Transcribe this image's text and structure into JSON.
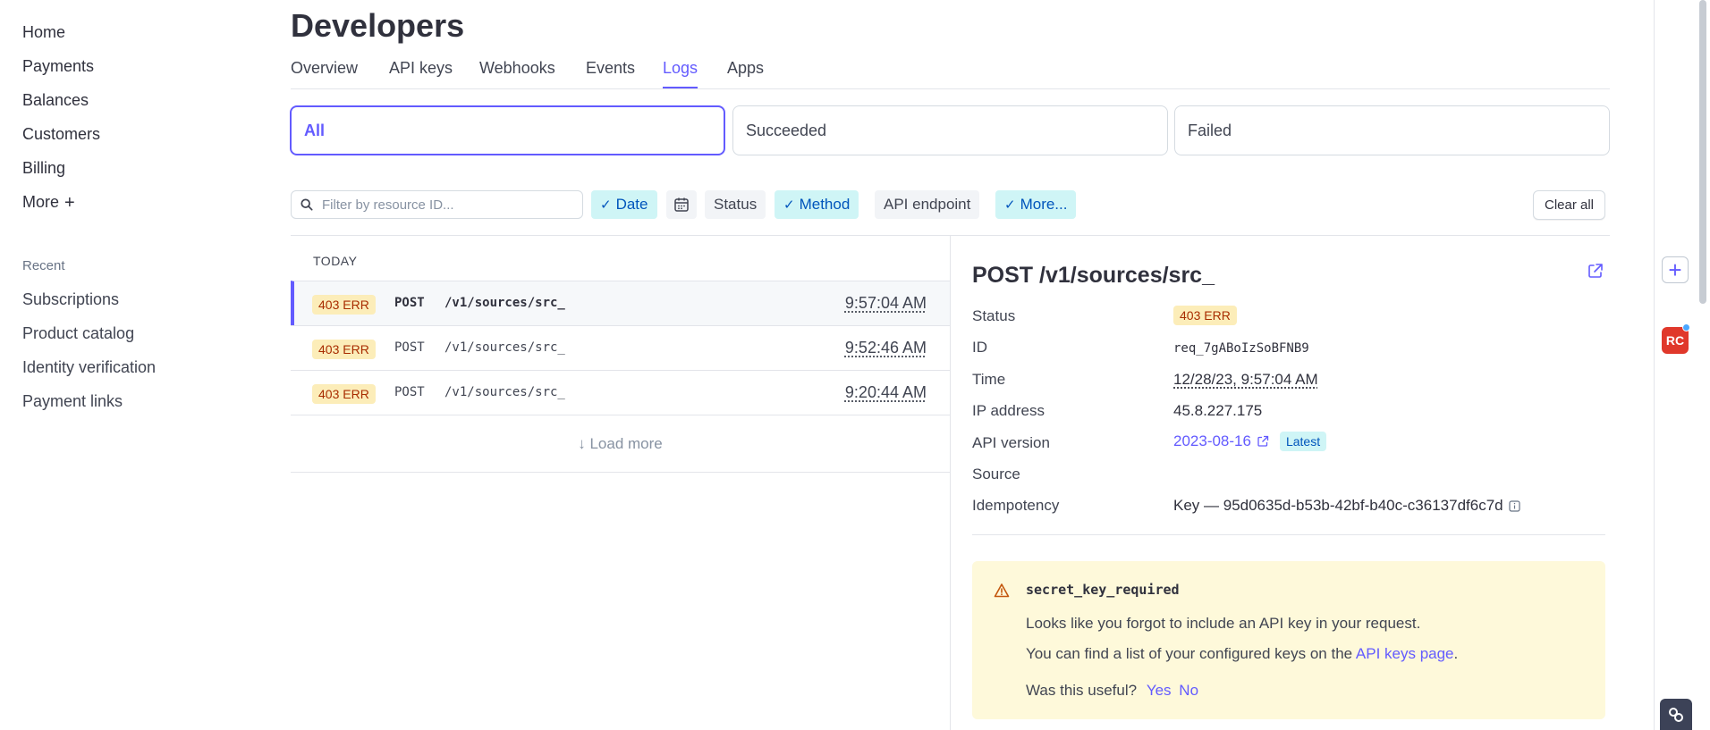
{
  "sidebar": {
    "nav": [
      "Home",
      "Payments",
      "Balances",
      "Customers",
      "Billing",
      "More"
    ],
    "more_plus": "+",
    "recent_label": "Recent",
    "recent": [
      "Subscriptions",
      "Product catalog",
      "Identity verification",
      "Payment links"
    ]
  },
  "page": {
    "title": "Developers",
    "tabs": [
      "Overview",
      "API keys",
      "Webhooks",
      "Events",
      "Logs",
      "Apps"
    ],
    "active_tab": "Logs"
  },
  "segments": {
    "items": [
      "All",
      "Succeeded",
      "Failed"
    ],
    "active": "All"
  },
  "filters": {
    "search_placeholder": "Filter by resource ID...",
    "chips": [
      "Date",
      "Status",
      "Method",
      "API endpoint",
      "More..."
    ],
    "checked_chips": [
      "Date",
      "Method",
      "More..."
    ],
    "check_glyph": "✓",
    "clear_all": "Clear all"
  },
  "logs": {
    "group_label": "TODAY",
    "rows": [
      {
        "badge": "403 ERR",
        "method": "POST",
        "path": "/v1/sources/src_",
        "time": "9:57:04 AM"
      },
      {
        "badge": "403 ERR",
        "method": "POST",
        "path": "/v1/sources/src_",
        "time": "9:52:46 AM"
      },
      {
        "badge": "403 ERR",
        "method": "POST",
        "path": "/v1/sources/src_",
        "time": "9:20:44 AM"
      }
    ],
    "load_more": "↓ Load more"
  },
  "detail": {
    "title": "POST /v1/sources/src_",
    "fields": {
      "status_label": "Status",
      "status_value": "403 ERR",
      "id_label": "ID",
      "id_value": "req_7gABoIzSoBFNB9",
      "time_label": "Time",
      "time_value": "12/28/23, 9:57:04 AM",
      "ip_label": "IP address",
      "ip_value": "45.8.227.175",
      "api_version_label": "API version",
      "api_version_value": "2023-08-16",
      "latest_badge": "Latest",
      "source_label": "Source",
      "idempotency_label": "Idempotency",
      "idempotency_value": "Key — 95d0635d-b53b-42bf-b40c-c36137df6c7d"
    },
    "alert": {
      "code": "secret_key_required",
      "line1": "Looks like you forgot to include an API key in your request.",
      "line2_prefix": "You can find a list of your configured keys on the ",
      "line2_link": "API keys page",
      "line2_suffix": ".",
      "useful_question": "Was this useful?",
      "yes": "Yes",
      "no": "No"
    }
  },
  "rail": {
    "plus": "+",
    "rc_badge": "RC"
  },
  "colors": {
    "accent": "#635bff",
    "error_badge_bg": "#fcedb9",
    "error_badge_text": "#a82c00",
    "chip_on_bg": "#cff5f6",
    "alert_bg": "#fef9da"
  }
}
